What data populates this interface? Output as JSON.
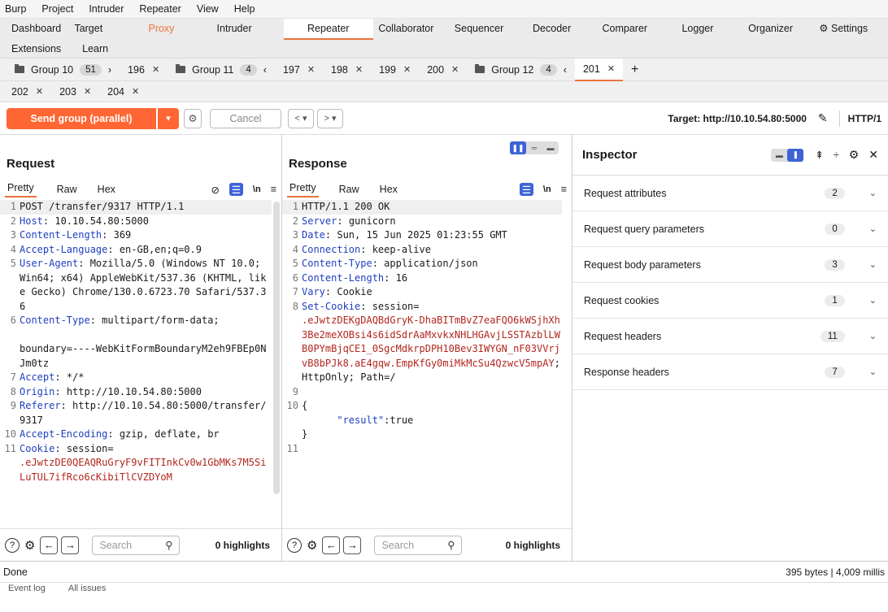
{
  "menubar": [
    "Burp",
    "Project",
    "Intruder",
    "Repeater",
    "View",
    "Help"
  ],
  "main_tabs": [
    "Dashboard",
    "Target",
    "Proxy",
    "Intruder",
    "Repeater",
    "Collaborator",
    "Sequencer",
    "Decoder",
    "Comparer",
    "Logger",
    "Organizer",
    "Settings"
  ],
  "main_tabs_row2": [
    "Extensions",
    "Learn"
  ],
  "group_tabs": {
    "g10": {
      "label": "Group 10",
      "count": "51"
    },
    "t196": "196",
    "g11": {
      "label": "Group 11",
      "count": "4"
    },
    "t197": "197",
    "t198": "198",
    "t199": "199",
    "t200": "200",
    "g12": {
      "label": "Group 12",
      "count": "4"
    },
    "t201": "201",
    "t202": "202",
    "t203": "203",
    "t204": "204"
  },
  "toolbar": {
    "send_label": "Send group (parallel)",
    "cancel_label": "Cancel",
    "target": "Target: http://10.10.54.80:5000",
    "http_version": "HTTP/1"
  },
  "request": {
    "title": "Request",
    "tabs": [
      "Pretty",
      "Raw",
      "Hex"
    ],
    "lines": [
      {
        "n": "1",
        "h": "",
        "v": "POST /transfer/9317 HTTP/1.1",
        "first": true
      },
      {
        "n": "2",
        "h": "Host",
        "v": "10.10.54.80:5000"
      },
      {
        "n": "3",
        "h": "Content-Length",
        "v": "369"
      },
      {
        "n": "4",
        "h": "Accept-Language",
        "v": "en-GB,en;q=0.9"
      },
      {
        "n": "5",
        "h": "User-Agent",
        "v": "Mozilla/5.0 (Windows NT 10.0; Win64; x64) AppleWebKit/537.36 (KHTML, like Gecko) Chrome/130.0.6723.70 Safari/537.36"
      },
      {
        "n": "6",
        "h": "Content-Type",
        "v": "multipart/form-data;\n\nboundary=----WebKitFormBoundaryM2eh9FBEp0NJm0tz"
      },
      {
        "n": "7",
        "h": "Accept",
        "v": "*/*"
      },
      {
        "n": "8",
        "h": "Origin",
        "v": "http://10.10.54.80:5000"
      },
      {
        "n": "9",
        "h": "Referer",
        "v": "http://10.10.54.80:5000/transfer/9317"
      },
      {
        "n": "10",
        "h": "Accept-Encoding",
        "v": "gzip, deflate, br"
      },
      {
        "n": "11",
        "h": "Cookie",
        "v": "session=",
        "red": ".eJwtzDE0QEAQRuGryF9vFITInkCv0w1GbMKs7M5SiLuTUL7ifRco6cKibiTlCVZDYoM"
      }
    ],
    "search_placeholder": "Search",
    "highlights": "0 highlights"
  },
  "response": {
    "title": "Response",
    "tabs": [
      "Pretty",
      "Raw",
      "Hex"
    ],
    "lines": [
      {
        "n": "1",
        "h": "",
        "v": "HTTP/1.1 200 OK",
        "first": true
      },
      {
        "n": "2",
        "h": "Server",
        "v": "gunicorn"
      },
      {
        "n": "3",
        "h": "Date",
        "v": "Sun, 15 Jun 2025 01:23:55 GMT"
      },
      {
        "n": "4",
        "h": "Connection",
        "v": "keep-alive"
      },
      {
        "n": "5",
        "h": "Content-Type",
        "v": "application/json"
      },
      {
        "n": "6",
        "h": "Content-Length",
        "v": "16"
      },
      {
        "n": "7",
        "h": "Vary",
        "v": "Cookie"
      },
      {
        "n": "8",
        "h": "Set-Cookie",
        "v": "session=",
        "red": ".eJwtzDEKgDAQBdGryK-DhaBITmBvZ7eaFQO6kWSjhXh3Be2meXOBsi4s6idSdrAaMxvkxNHLHGAvjLSSTAzblLWB0PYmBjqCE1_0SgcMdkrpDPH10Bev3IWYGN_nF03VVrjvB8bPJk8.aE4gqw.EmpKfGy0miMkMcSu4QzwcV5mpAY",
        "tail": "; HttpOnly; Path=/"
      },
      {
        "n": "9",
        "h": "",
        "v": ""
      },
      {
        "n": "10",
        "h": "",
        "v": "{"
      },
      {
        "n": "",
        "h": "",
        "v": "",
        "json": {
          "key": "\"result\"",
          "val": ":true"
        }
      },
      {
        "n": "",
        "h": "",
        "v": "}"
      },
      {
        "n": "11",
        "h": "",
        "v": ""
      }
    ],
    "search_placeholder": "Search",
    "highlights": "0 highlights"
  },
  "inspector": {
    "title": "Inspector",
    "rows": [
      {
        "label": "Request attributes",
        "count": "2"
      },
      {
        "label": "Request query parameters",
        "count": "0"
      },
      {
        "label": "Request body parameters",
        "count": "3"
      },
      {
        "label": "Request cookies",
        "count": "1"
      },
      {
        "label": "Request headers",
        "count": "11"
      },
      {
        "label": "Response headers",
        "count": "7"
      }
    ]
  },
  "status": {
    "left": "Done",
    "right": "395 bytes | 4,009 millis"
  },
  "footer": {
    "event_log": "Event log",
    "all_issues": "All issues"
  }
}
